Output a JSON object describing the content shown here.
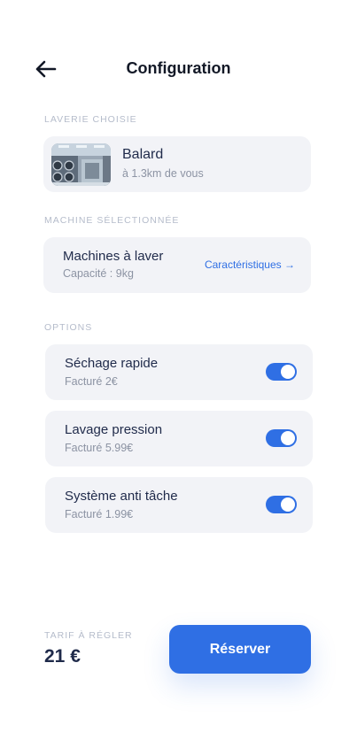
{
  "header": {
    "title": "Configuration",
    "back_icon": "arrow-left-icon"
  },
  "laverie": {
    "section_label": "LAVERIE CHOISIE",
    "name": "Balard",
    "distance": "à 1.3km de vous",
    "thumbnail": "laundromat-photo"
  },
  "machine": {
    "section_label": "MACHINE SÉLECTIONNÉE",
    "name": "Machines à laver",
    "capacity": "Capacité : 9kg",
    "link_label": "Caractéristiques →"
  },
  "options": {
    "section_label": "OPTIONS",
    "items": [
      {
        "name": "Séchage rapide",
        "price": "Facturé 2€",
        "enabled": true
      },
      {
        "name": "Lavage pression",
        "price": "Facturé 5.99€",
        "enabled": true
      },
      {
        "name": "Système anti tâche",
        "price": "Facturé 1.99€",
        "enabled": true
      }
    ]
  },
  "footer": {
    "tarif_label": "TARIF À RÉGLER",
    "tarif_value": "21 €",
    "reserve_label": "Réserver"
  },
  "colors": {
    "accent": "#2f6fe4",
    "card_bg": "#f2f3f7",
    "text_dark": "#1f2a4a",
    "text_muted": "#8c93a3"
  }
}
